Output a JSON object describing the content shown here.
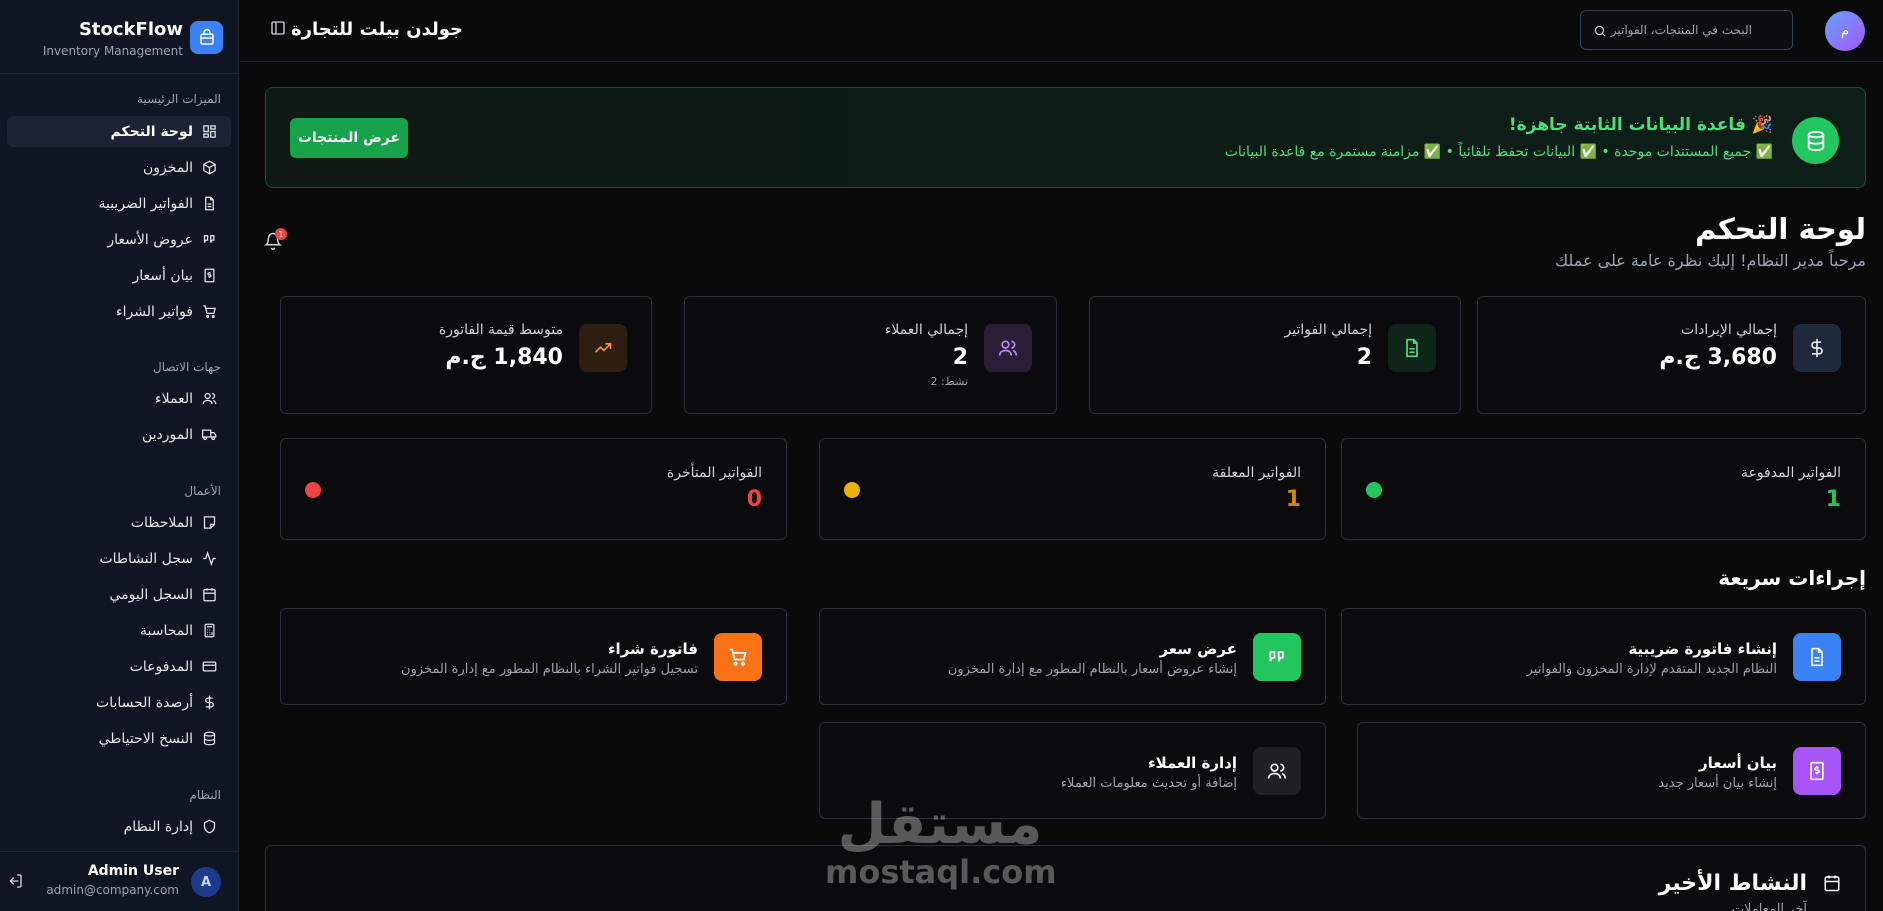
{
  "brand": {
    "name": "StockFlow",
    "subtitle": "Inventory Management"
  },
  "sidebar": {
    "sections": [
      {
        "label": "الميزات الرئيسية",
        "items": [
          {
            "label": "لوحة التحكم",
            "icon": "dashboard-icon",
            "active": true
          },
          {
            "label": "المخزون",
            "icon": "package-icon"
          },
          {
            "label": "الفواتير الضريبية",
            "icon": "file-text-icon"
          },
          {
            "label": "عروض الأسعار",
            "icon": "quote-icon"
          },
          {
            "label": "بيان أسعار",
            "icon": "receipt-dollar-icon"
          },
          {
            "label": "فواتير الشراء",
            "icon": "cart-icon"
          }
        ]
      },
      {
        "label": "جهات الاتصال",
        "items": [
          {
            "label": "العملاء",
            "icon": "users-icon"
          },
          {
            "label": "الموردين",
            "icon": "truck-icon"
          }
        ]
      },
      {
        "label": "الأعمال",
        "items": [
          {
            "label": "الملاحظات",
            "icon": "sticky-note-icon"
          },
          {
            "label": "سجل النشاطات",
            "icon": "activity-icon"
          },
          {
            "label": "السجل اليومي",
            "icon": "calendar-icon"
          },
          {
            "label": "المحاسبة",
            "icon": "calculator-icon"
          },
          {
            "label": "المدفوعات",
            "icon": "credit-card-icon"
          },
          {
            "label": "أرصدة الحسابات",
            "icon": "dollar-icon"
          },
          {
            "label": "النسخ الاحتياطي",
            "icon": "database-icon"
          }
        ]
      },
      {
        "label": "النظام",
        "items": [
          {
            "label": "إدارة النظام",
            "icon": "shield-icon"
          }
        ]
      }
    ]
  },
  "user": {
    "initial": "A",
    "name": "Admin User",
    "email": "admin@company.com"
  },
  "header": {
    "company": "جولدن بيلت للتجارة",
    "search_placeholder": "البحث في المنتجات، الفواتير",
    "avatar_initial": "م"
  },
  "banner": {
    "title": "🎉 قاعدة البيانات الثابتة جاهزة!",
    "subtitle": "✅ جميع المستندات موحدة • ✅ البيانات تحفظ تلقائياً • ✅ مزامنة مستمرة مع قاعدة البيانات",
    "button": "عرض المنتجات"
  },
  "page": {
    "title": "لوحة التحكم",
    "subtitle": "مرحباً مدير النظام! إليك نظرة عامة على عملك",
    "notifications": "1"
  },
  "stats": [
    {
      "label": "إجمالي الإيرادات",
      "value": "3,680 ج.م",
      "icon": "dollar-icon"
    },
    {
      "label": "إجمالي الفواتير",
      "value": "2",
      "icon": "file-text-icon"
    },
    {
      "label": "إجمالي العملاء",
      "value": "2",
      "note": "نشط: 2",
      "icon": "users-icon"
    },
    {
      "label": "متوسط قيمة الفاتورة",
      "value": "1,840 ج.م",
      "icon": "trending-up-icon"
    }
  ],
  "statuses": [
    {
      "label": "الفواتير المدفوعة",
      "value": "1",
      "color": "#22c55e"
    },
    {
      "label": "الفواتير المعلقة",
      "value": "1",
      "color": "#eab308"
    },
    {
      "label": "الفواتير المتأخرة",
      "value": "0",
      "color": "#ef4444"
    }
  ],
  "quick_actions": {
    "title": "إجراءات سريعة",
    "items": [
      {
        "title": "إنشاء فاتورة ضريبية",
        "desc": "النظام الجديد المتقدم لإدارة المخزون والفواتير",
        "color": "#3b82f6",
        "icon": "file-text-icon"
      },
      {
        "title": "عرض سعر",
        "desc": "إنشاء عروض أسعار بالنظام المطور مع إدارة المخزون",
        "color": "#22c55e",
        "icon": "quote-icon"
      },
      {
        "title": "فاتورة شراء",
        "desc": "تسجيل فواتير الشراء بالنظام المطور مع إدارة المخزون",
        "color": "#f97316",
        "icon": "cart-icon"
      },
      {
        "title": "بيان أسعار",
        "desc": "إنشاء بيان أسعار جديد",
        "color": "#a855f7",
        "icon": "receipt-dollar-icon"
      },
      {
        "title": "إدارة العملاء",
        "desc": "إضافة أو تحديث معلومات العملاء",
        "color": "#1f2023",
        "icon": "users-icon"
      }
    ]
  },
  "activity": {
    "title": "النشاط الأخير",
    "subtitle": "آخر المعاملات"
  },
  "watermark": {
    "logo": "مستقل",
    "text": "mostaql.com"
  }
}
